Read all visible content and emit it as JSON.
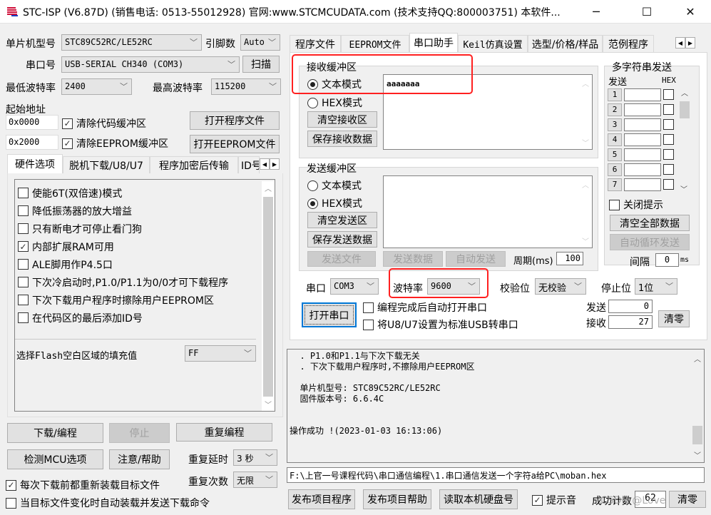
{
  "window": {
    "title": "STC-ISP (V6.87D) (销售电话: 0513-55012928) 官网:www.STCMCUDATA.com  (技术支持QQ:800003751) 本软件...",
    "minimize_icon": "─",
    "maximize_icon": "☐",
    "close_icon": "✕"
  },
  "left": {
    "mcu_type_label": "单片机型号",
    "mcu_type_value": "STC89C52RC/LE52RC",
    "pins_label": "引脚数",
    "pins_value": "Auto",
    "port_label": "串口号",
    "port_value": "USB-SERIAL CH340 (COM3)",
    "scan_button": "扫描",
    "min_baud_label": "最低波特率",
    "min_baud_value": "2400",
    "max_baud_label": "最高波特率",
    "max_baud_value": "115200",
    "start_addr_label": "起始地址",
    "addr1_value": "0x0000",
    "clear_code_label": "清除代码缓冲区",
    "clear_code_checked": true,
    "open_program_button": "打开程序文件",
    "addr2_value": "0x2000",
    "clear_eeprom_label": "清除EEPROM缓冲区",
    "clear_eeprom_checked": true,
    "open_eeprom_button": "打开EEPROM文件",
    "tabs": [
      "硬件选项",
      "脱机下载/U8/U7",
      "程序加密后传输",
      "ID号"
    ],
    "active_tab": 0,
    "options": [
      {
        "label": "使能6T(双倍速)模式",
        "checked": false
      },
      {
        "label": "降低振荡器的放大增益",
        "checked": false
      },
      {
        "label": "只有断电才可停止看门狗",
        "checked": false
      },
      {
        "label": "内部扩展RAM可用",
        "checked": true
      },
      {
        "label": "ALE脚用作P4.5口",
        "checked": false
      },
      {
        "label": "下次冷启动时,P1.0/P1.1为0/0才可下载程序",
        "checked": false
      },
      {
        "label": "下次下载用户程序时擦除用户EEPROM区",
        "checked": false
      },
      {
        "label": "在代码区的最后添加ID号",
        "checked": false
      }
    ],
    "fill_label": "选择Flash空白区域的填充值",
    "fill_value": "FF",
    "download_button": "下载/编程",
    "stop_button": "停止",
    "repeat_program_button": "重复编程",
    "detect_mcu_button": "检测MCU选项",
    "help_button": "注意/帮助",
    "repeat_delay_label": "重复延时",
    "repeat_delay_value": "3 秒",
    "repeat_count_label": "重复次数",
    "repeat_count_value": "无限",
    "reload_label": "每次下载前都重新装载目标文件",
    "reload_checked": true,
    "auto_load_label": "当目标文件变化时自动装载并发送下载命令",
    "auto_load_checked": false
  },
  "right": {
    "tabs": [
      "程序文件",
      "EEPROM文件",
      "串口助手",
      "Keil仿真设置",
      "选型/价格/样品",
      "范例程序"
    ],
    "active_tab": 2,
    "recv": {
      "title": "接收缓冲区",
      "text_mode_label": "文本模式",
      "hex_mode_label": "HEX模式",
      "mode": "text",
      "clear_button": "清空接收区",
      "save_button": "保存接收数据",
      "content": "aaaaaaa"
    },
    "send": {
      "title": "发送缓冲区",
      "text_mode_label": "文本模式",
      "hex_mode_label": "HEX模式",
      "mode": "hex",
      "clear_button": "清空发送区",
      "save_button": "保存发送数据",
      "content": "",
      "send_file_button": "发送文件",
      "send_data_button": "发送数据",
      "auto_send_button": "自动发送",
      "period_label": "周期(ms)",
      "period_value": "100"
    },
    "multi": {
      "title": "多字符串发送",
      "send_header": "发送",
      "hex_header": "HEX",
      "rows": [
        "1",
        "2",
        "3",
        "4",
        "5",
        "6",
        "7"
      ],
      "close_tip_label": "关闭提示",
      "clear_all_button": "清空全部数据",
      "auto_loop_button": "自动循环发送",
      "interval_label": "间隔",
      "interval_value": "0",
      "interval_unit": "ms"
    },
    "serial": {
      "port_label": "串口",
      "port_value": "COM3",
      "baud_label": "波特率",
      "baud_value": "9600",
      "parity_label": "校验位",
      "parity_value": "无校验",
      "stop_label": "停止位",
      "stop_value": "1位",
      "open_button": "打开串口",
      "auto_open_label": "编程完成后自动打开串口",
      "usb_label": "将U8/U7设置为标准USB转串口",
      "sent_label": "发送",
      "sent_value": "0",
      "recv_label": "接收",
      "recv_value": "27",
      "clear_button": "清零"
    },
    "log": [
      "  . P1.0和P1.1与下次下载无关",
      "  . 下次下载用户程序时,不擦除用户EEPROM区",
      "",
      "  单片机型号: STC89C52RC/LE52RC",
      "  固件版本号: 6.6.4C",
      "",
      "",
      "操作成功 !(2023-01-03 16:13:06)"
    ],
    "path": "F:\\上官一号课程代码\\串口通信编程\\1.串口通信发送一个字符a给PC\\moban.hex",
    "publish_program_button": "发布项目程序",
    "publish_help_button": "发布项目帮助",
    "read_disk_button": "读取本机硬盘号",
    "sound_label": "提示音",
    "sound_checked": true,
    "success_count_label": "成功计数",
    "success_count_value": "62",
    "clear_count_button": "清零",
    "watermark": "CSDN @Love"
  }
}
